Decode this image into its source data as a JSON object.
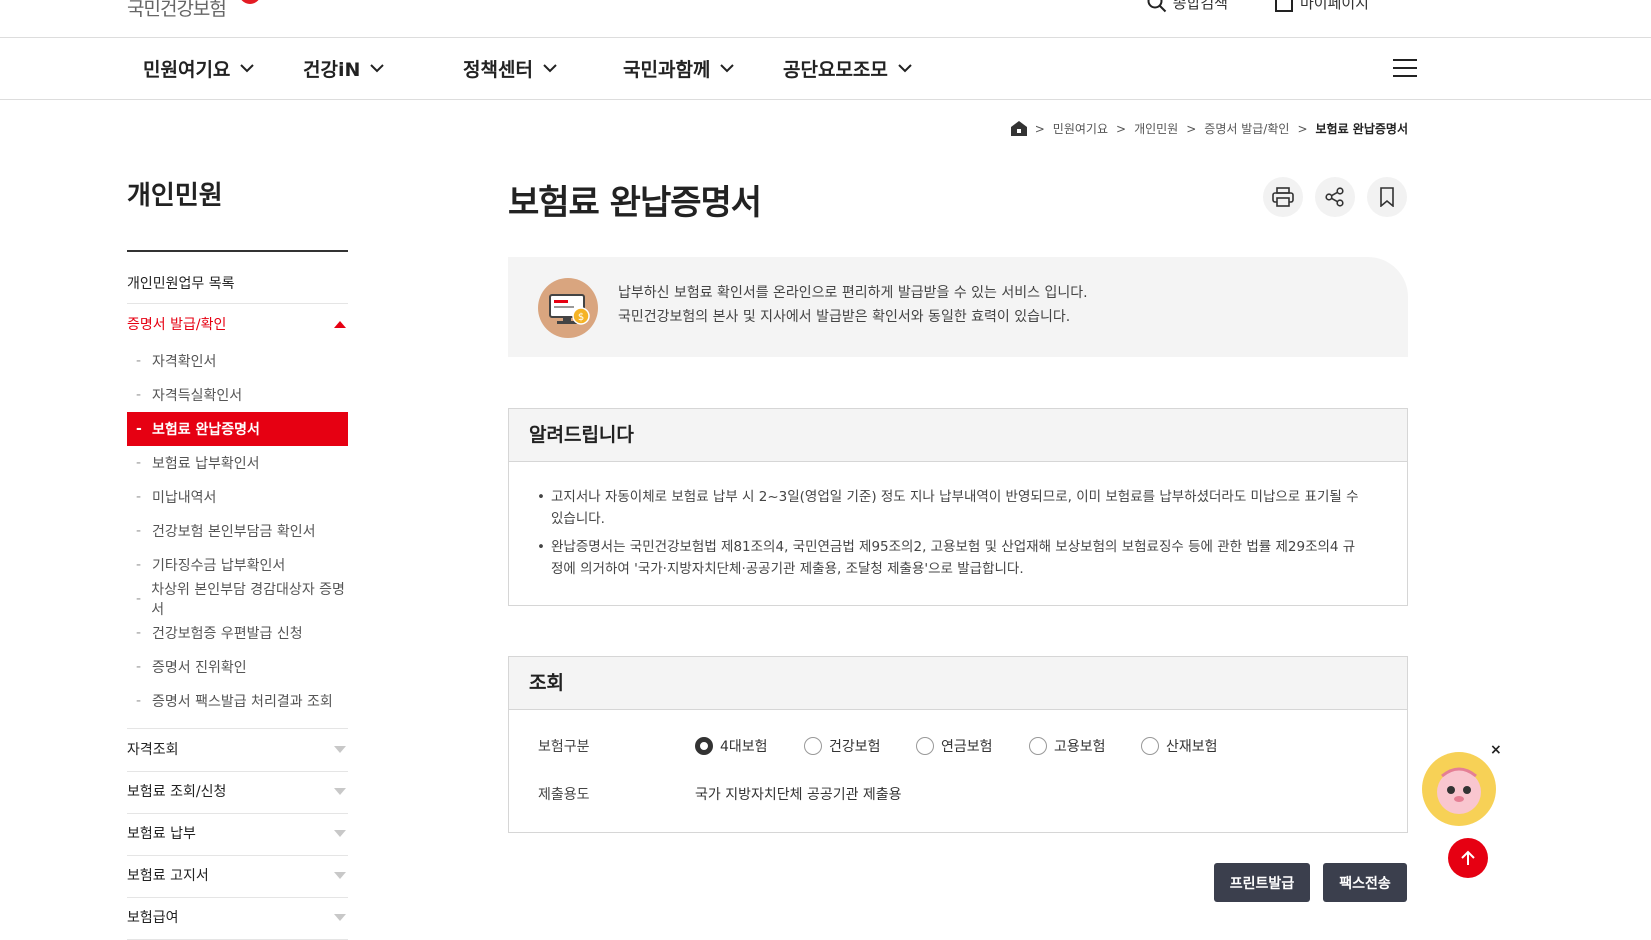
{
  "header": {
    "logo_text": "국민건강보험",
    "util_links": [
      "종합검색",
      "마이페이지"
    ],
    "nav": [
      "민원여기요",
      "건강iN",
      "정책센터",
      "국민과함께",
      "공단요모조모"
    ]
  },
  "breadcrumb": [
    "민원여기요",
    "개인민원",
    "증명서 발급/확인",
    "보험료 완납증명서"
  ],
  "sidebar": {
    "title": "개인민원",
    "top_item": "개인민원업무 목록",
    "open_group": "증명서 발급/확인",
    "sub_items": [
      "자격확인서",
      "자격득실확인서",
      "보험료 완납증명서",
      "보험료 납부확인서",
      "미납내역서",
      "건강보험 본인부담금 확인서",
      "기타징수금 납부확인서",
      "차상위 본인부담 경감대상자 증명서",
      "건강보험증 우편발급 신청",
      "증명서 진위확인",
      "증명서 팩스발급 처리결과 조회"
    ],
    "active_index": 2,
    "groups": [
      "자격조회",
      "보험료 조회/신청",
      "보험료 납부",
      "보험료 고지서",
      "보험급여"
    ]
  },
  "main": {
    "title": "보험료 완납증명서",
    "intro_lines": [
      "납부하신 보험료 확인서를 온라인으로 편리하게 발급받을 수 있는 서비스 입니다.",
      "국민건강보험의 본사 및 지사에서 발급받은 확인서와 동일한 효력이 있습니다."
    ],
    "notice_title": "알려드립니다",
    "notices": [
      "고지서나 자동이체로 보험료 납부 시 2~3일(영업일 기준) 정도 지나 납부내역이 반영되므로, 이미 보험료를 납부하셨더라도 미납으로 표기될 수 있습니다.",
      "완납증명서는 국민건강보험법 제81조의4, 국민연금법 제95조의2, 고용보험 및 산업재해 보상보험의 보험료징수 등에 관한 법률 제29조의4 규정에 의거하여 '국가·지방자치단체·공공기관 제출용, 조달청 제출용'으로 발급합니다."
    ],
    "query_title": "조회",
    "insurance_label": "보험구분",
    "insurance_options": [
      "4대보험",
      "건강보험",
      "연금보험",
      "고용보험",
      "산재보험"
    ],
    "insurance_selected": "4대보험",
    "purpose_label": "제출용도",
    "purpose_value": "국가 지방자치단체 공공기관 제출용",
    "print_button": "프린트발급",
    "fax_button": "팩스전송"
  },
  "colors": {
    "accent": "#e60012",
    "dark_button": "#3b3f4d"
  }
}
